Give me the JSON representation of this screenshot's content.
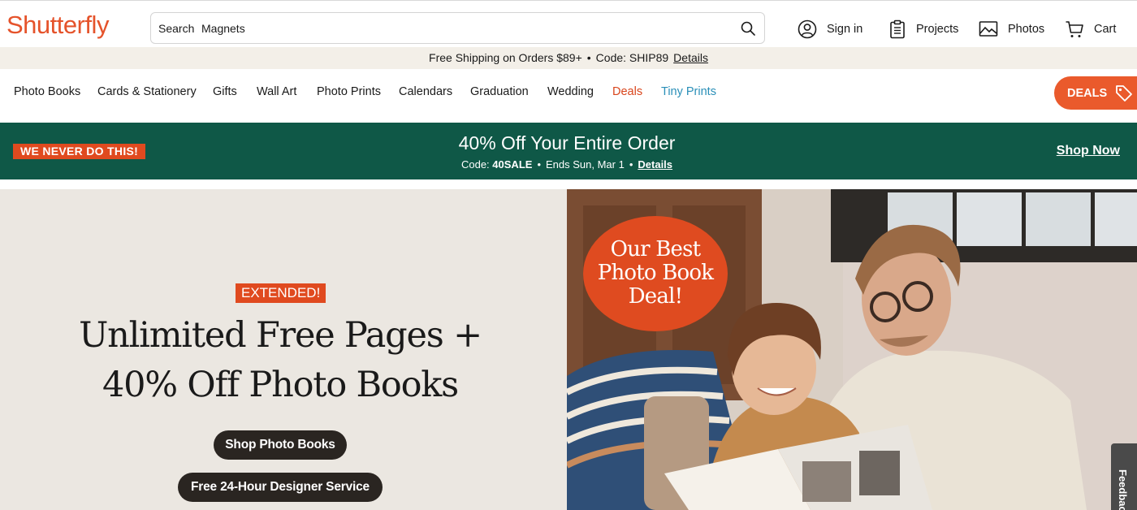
{
  "header": {
    "logo": "Shutterfly",
    "search": {
      "label": "Search",
      "value": "Magnets",
      "placeholder": ""
    },
    "sign_in": "Sign in",
    "projects": "Projects",
    "photos": "Photos",
    "cart": "Cart"
  },
  "promo_strip": {
    "text": "Free Shipping on Orders $89+",
    "separator": "•",
    "code": "Code: SHIP89",
    "link": "Details"
  },
  "nav": {
    "items": [
      {
        "label": "Photo Books"
      },
      {
        "label": "Cards & Stationery"
      },
      {
        "label": "Gifts"
      },
      {
        "label": "Wall Art"
      },
      {
        "label": "Photo Prints"
      },
      {
        "label": "Calendars"
      },
      {
        "label": "Graduation"
      },
      {
        "label": "Wedding"
      },
      {
        "label": "Deals"
      },
      {
        "label": "Tiny Prints"
      }
    ],
    "deals_button": "DEALS"
  },
  "banner": {
    "badge": "WE NEVER DO THIS!",
    "title": "40% Off Your Entire Order",
    "code_prefix": "Code:",
    "code": "40SALE",
    "dot": "•",
    "ends": "Ends Sun, Mar 1",
    "details": "Details",
    "shop_now": "Shop Now"
  },
  "hero": {
    "tag": "EXTENDED!",
    "title_line1": "Unlimited Free Pages +",
    "title_line2": "40% Off  Photo Books",
    "button_primary": "Shop Photo Books",
    "button_secondary": "Free 24-Hour Designer Service",
    "circle_line1": "Our Best",
    "circle_line2": "Photo Book",
    "circle_line3": "Deal!"
  },
  "feedback": "Feedback",
  "colors": {
    "brand_orange": "#e5532b",
    "deals_red": "#d9451c",
    "tiny_prints_blue": "#2a8fb8",
    "banner_green": "#0f5847",
    "hero_bg": "#ebe7e1",
    "button_dark": "#2a2521"
  }
}
